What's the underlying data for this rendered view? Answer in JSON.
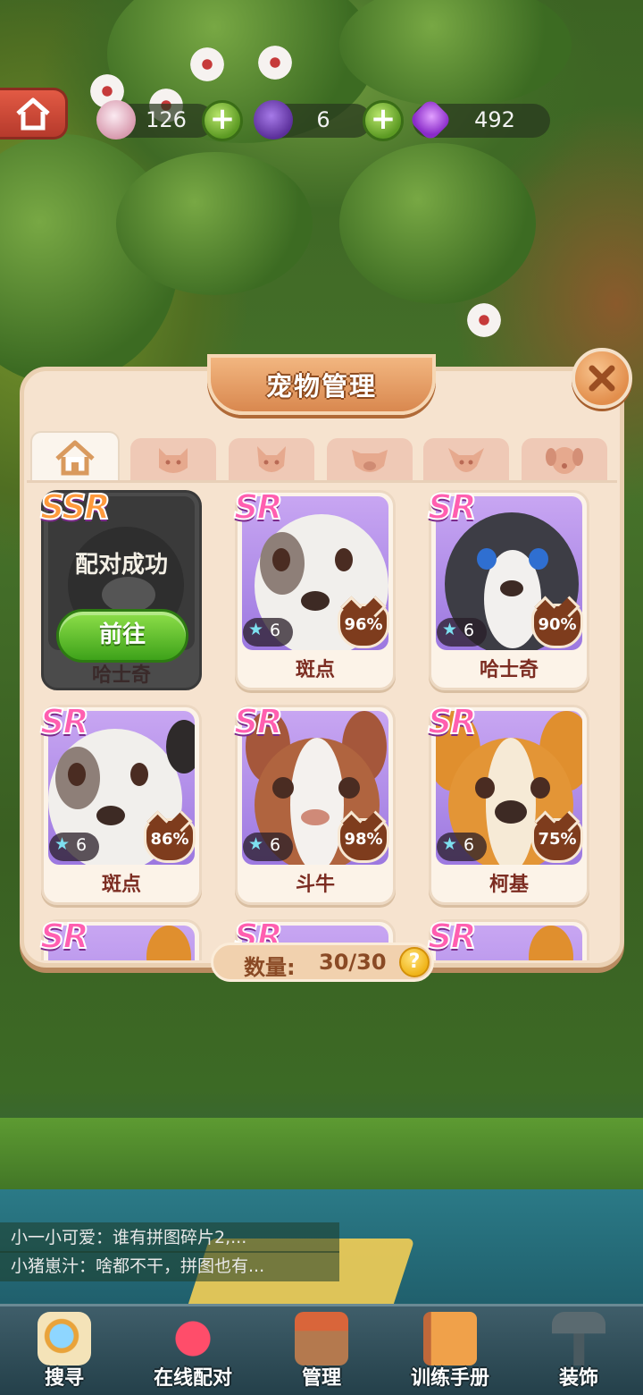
{
  "currencies": [
    {
      "name": "bottle",
      "icon": "milk-bottle-icon",
      "amount": "126"
    },
    {
      "name": "yarn",
      "icon": "yarn-ball-icon",
      "amount": "6"
    },
    {
      "name": "gem",
      "icon": "purple-gem-icon",
      "amount": "492"
    }
  ],
  "panel": {
    "title": "宠物管理",
    "tabs": [
      {
        "icon": "home-icon",
        "active": true
      },
      {
        "icon": "cat-face-icon",
        "active": false
      },
      {
        "icon": "fox-face-icon",
        "active": false
      },
      {
        "icon": "pig-face-icon",
        "active": false
      },
      {
        "icon": "deer-face-icon",
        "active": false
      },
      {
        "icon": "dog-face-icon",
        "active": false
      }
    ],
    "paired_card": {
      "rarity": "SSR",
      "status": "配对成功",
      "button": "前往",
      "name": "哈士奇"
    },
    "pets": [
      {
        "rarity": "SR",
        "stars": "6",
        "percent": "96%",
        "name": "斑点"
      },
      {
        "rarity": "SR",
        "stars": "6",
        "percent": "90%",
        "name": "哈士奇"
      },
      {
        "rarity": "SR",
        "stars": "6",
        "percent": "86%",
        "name": "斑点"
      },
      {
        "rarity": "SR",
        "stars": "6",
        "percent": "98%",
        "name": "斗牛"
      },
      {
        "rarity": "SR",
        "stars": "6",
        "percent": "75%",
        "name": "柯基"
      },
      {
        "rarity": "SR"
      },
      {
        "rarity": "SR"
      },
      {
        "rarity": "SR"
      }
    ],
    "count_label": "数量:",
    "count_value": "30/30",
    "help": "?"
  },
  "chat": [
    "小一小可爱：谁有拼图碎片2,...",
    "小猪崽汁：啥都不干，拼图也有..."
  ],
  "nav": [
    {
      "label": "搜寻",
      "icon": "magnifier-map-icon"
    },
    {
      "label": "在线配对",
      "icon": "heart-arrow-icon"
    },
    {
      "label": "管理",
      "icon": "pet-house-icon"
    },
    {
      "label": "训练手册",
      "icon": "notebook-icon"
    },
    {
      "label": "装饰",
      "icon": "hammer-icon"
    }
  ],
  "colors": {
    "panel_bg": "#f6e3cf",
    "title_ribbon": "#e09a5f",
    "rarity_text": "#ff5fb0",
    "go_button": "#5cbf2a",
    "percent_badge": "#7e3c1d"
  }
}
